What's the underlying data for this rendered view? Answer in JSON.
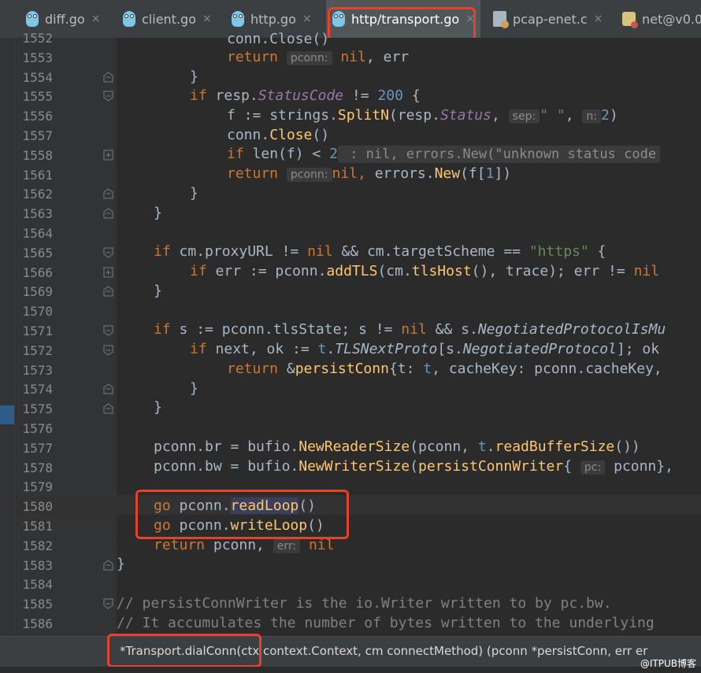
{
  "tabs": [
    {
      "label": "diff.go",
      "icon": "go-gopher-icon"
    },
    {
      "label": "client.go",
      "icon": "go-gopher-icon"
    },
    {
      "label": "http.go",
      "icon": "go-gopher-icon"
    },
    {
      "label": "http/transport.go",
      "icon": "go-gopher-icon",
      "active": true
    },
    {
      "label": "pcap-enet.c",
      "icon": "c-file-icon"
    },
    {
      "label": "net@v0.0.",
      "icon": "package-icon"
    }
  ],
  "close_glyph": "×",
  "lines": [
    {
      "n": "1552"
    },
    {
      "n": "1553"
    },
    {
      "n": "1554"
    },
    {
      "n": "1555"
    },
    {
      "n": "1556"
    },
    {
      "n": "1557"
    },
    {
      "n": "1558"
    },
    {
      "n": "1561"
    },
    {
      "n": "1562"
    },
    {
      "n": "1563"
    },
    {
      "n": "1564"
    },
    {
      "n": "1565"
    },
    {
      "n": "1566"
    },
    {
      "n": "1569"
    },
    {
      "n": "1570"
    },
    {
      "n": "1571"
    },
    {
      "n": "1572"
    },
    {
      "n": "1573"
    },
    {
      "n": "1574"
    },
    {
      "n": "1575"
    },
    {
      "n": "1576"
    },
    {
      "n": "1577"
    },
    {
      "n": "1578"
    },
    {
      "n": "1579"
    },
    {
      "n": "1580"
    },
    {
      "n": "1581"
    },
    {
      "n": "1582"
    },
    {
      "n": "1583"
    },
    {
      "n": "1584"
    },
    {
      "n": "1585"
    },
    {
      "n": "1586"
    }
  ],
  "code": {
    "l1552a": "conn.Close()",
    "l1553_ret": "return",
    "l1553_hint": "pconn:",
    "l1553_rest": "nil, err",
    "l1554": "}",
    "l1555_if": "if",
    "l1555_a": " resp.",
    "l1555_b": "StatusCode",
    "l1555_c": " != ",
    "l1555_num": "200",
    "l1555_d": " {",
    "l1556_a": "f := ",
    "l1556_pkg": "strings",
    "l1556_dot": ".",
    "l1556_fn": "SplitN",
    "l1556_b": "(resp.",
    "l1556_c": "Status",
    "l1556_d": ",",
    "l1556_hint1": "sep:",
    "l1556_str": "\" \"",
    "l1556_e": ",",
    "l1556_hint2": "n:",
    "l1556_num": "2",
    "l1556_f": ")",
    "l1557_a": "conn.",
    "l1557_fn": "Close",
    "l1557_b": "()",
    "l1558_if": "if",
    "l1558_a": " len(f) < ",
    "l1558_num": "2",
    "l1558_fold": " : nil, errors.New(\"unknown status code",
    "l1561_ret": "return",
    "l1561_hint": "pconn:",
    "l1561_a": "nil, ",
    "l1561_pkg": "errors",
    "l1561_dot": ".",
    "l1561_fn": "New",
    "l1561_b": "(f[",
    "l1561_num": "1",
    "l1561_c": "])",
    "l1562": "}",
    "l1563": "}",
    "l1565_if": "if",
    "l1565_a": " cm.proxyURL != ",
    "l1565_nil": "nil",
    "l1565_b": " && cm.targetScheme == ",
    "l1565_str": "\"https\"",
    "l1565_c": " {",
    "l1566_if": "if",
    "l1566_a": " err := pconn.",
    "l1566_fn": "addTLS",
    "l1566_b": "(cm.",
    "l1566_fn2": "tlsHost",
    "l1566_c": "(), trace); err != ",
    "l1566_nil": "nil",
    "l1569": "}",
    "l1571_if": "if",
    "l1571_a": " s := pconn.tlsState; s != ",
    "l1571_nil": "nil",
    "l1571_b": " && s.",
    "l1571_c": "NegotiatedProtocolIsMu",
    "l1572_if": "if",
    "l1572_a": " next, ok := ",
    "l1572_t": "t",
    "l1572_b": ".",
    "l1572_c": "TLSNextProto",
    "l1572_d": "[s.",
    "l1572_e": "NegotiatedProtocol",
    "l1572_f": "]; ok",
    "l1573_ret": "return",
    "l1573_a": " &",
    "l1573_fn": "persistConn",
    "l1573_b": "{t: ",
    "l1573_t": "t",
    "l1573_c": ", cacheKey: pconn.cacheKey,",
    "l1574": "}",
    "l1575": "}",
    "l1577_a": "pconn.br = ",
    "l1577_pkg": "bufio",
    "l1577_dot": ".",
    "l1577_fn": "NewReaderSize",
    "l1577_b": "(pconn, ",
    "l1577_t": "t",
    "l1577_c": ".",
    "l1577_fn2": "readBufferSize",
    "l1577_d": "())",
    "l1578_a": "pconn.bw = ",
    "l1578_pkg": "bufio",
    "l1578_dot": ".",
    "l1578_fn": "NewWriterSize",
    "l1578_b": "(",
    "l1578_fn2": "persistConnWriter",
    "l1578_c": "{",
    "l1578_hint": "pc:",
    "l1578_d": "pconn},",
    "l1580_go": "go",
    "l1580_a": " pconn.",
    "l1580_fn": "readLoop",
    "l1580_b": "()",
    "l1581_go": "go",
    "l1581_a": " pconn.",
    "l1581_fn": "writeLoop",
    "l1581_b": "()",
    "l1582_ret": "return",
    "l1582_a": " pconn,",
    "l1582_hint": "err:",
    "l1582_nil": "nil",
    "l1583": "}",
    "l1585": "// persistConnWriter is the io.Writer written to by pc.bw.",
    "l1586": "// It accumulates the number of bytes written to the underlying"
  },
  "status_signature": "*Transport.dialConn(ctx context.Context, cm connectMethod) (pconn *persistConn, err er",
  "watermark": "@ITPUB博客",
  "colors": {
    "highlight_box": "#e8412b",
    "keyword": "#cc7832",
    "function": "#ffc66d",
    "number": "#6897bb",
    "string": "#6a8759"
  }
}
